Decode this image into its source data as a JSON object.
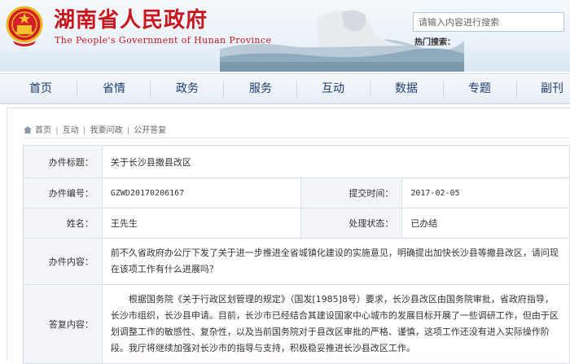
{
  "header": {
    "title": "湖南省人民政府",
    "subtitle": "The People's Government of Hunan Province",
    "search_placeholder": "请输入内容进行搜索",
    "hot_search_label": "热门搜索："
  },
  "nav": {
    "items": [
      "首页",
      "省情",
      "政务",
      "服务",
      "互动",
      "数据",
      "专题",
      "副刊"
    ]
  },
  "breadcrumb": [
    "首页",
    "互动",
    "我要问政",
    "公开答复"
  ],
  "letter": {
    "title_label": "办件标题：",
    "title": "关于长沙县撤县改区",
    "id_label": "办件编号：",
    "id": "GZWD20170206167",
    "date_label": "提交时间：",
    "date": "2017-02-05",
    "name_label": "姓名：",
    "name": "王先生",
    "status_label": "处理状态：",
    "status": "已办结",
    "content_label": "办件内容：",
    "content": "前不久省政府办公厅下发了关于进一步推进全省城镇化建设的实施意见，明确提出加快长沙县等撤县改区，请问现在该项工作有什么进展吗？",
    "reply_label": "答复内容：",
    "reply": "根据国务院《关于行政区划管理的规定》（国发[1985]8号）要求，长沙县改区由国务院审批，省政府指导，长沙市组织，长沙县申请。目前，长沙市已经结合其建设国家中心城市的发展目标开展了一些调研工作，但由于区划调整工作的敏感性、复杂性，以及当前国务院对于县改区审批的严格、谨慎，这项工作还没有进入实际操作阶段。我厅将继续加强对长沙市的指导与支持，积极稳妥推进长沙县改区工作。"
  },
  "colors": {
    "title_red": "#c8161d",
    "nav_text": "#1d3c70",
    "label_bg": "#f3f5f8"
  }
}
